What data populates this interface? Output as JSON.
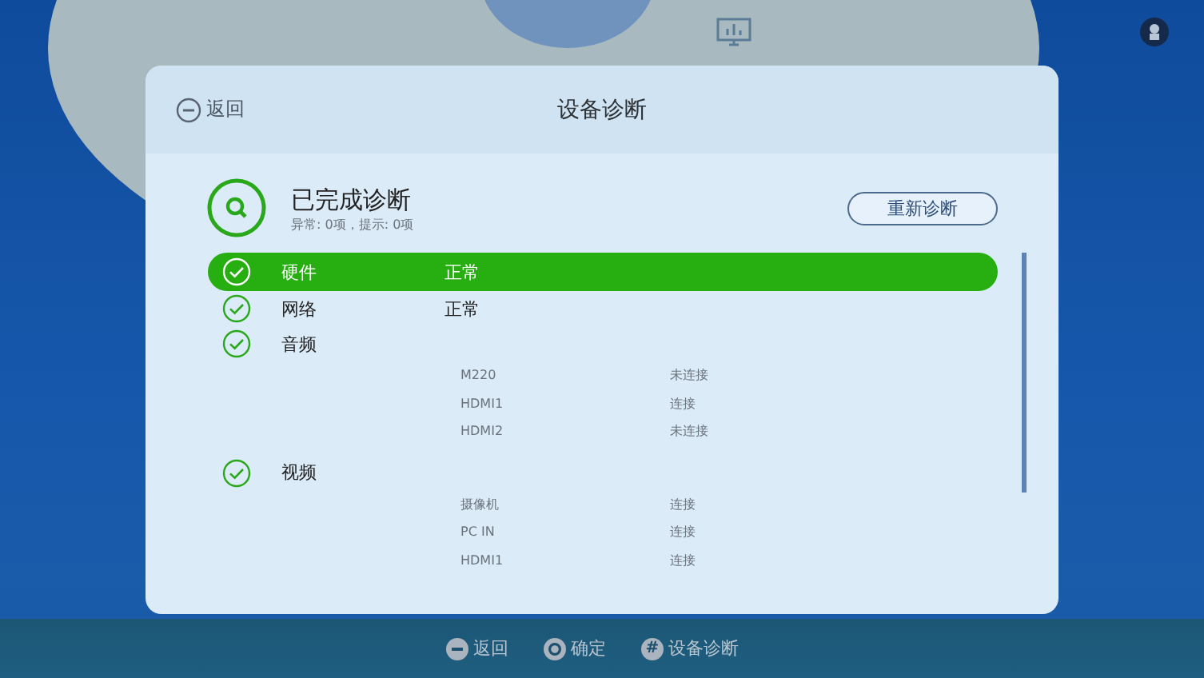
{
  "header": {
    "back": "返回",
    "title": "设备诊断"
  },
  "summary": {
    "title": "已完成诊断",
    "detail": "异常: 0项，提示: 0项",
    "rerun_button": "重新诊断"
  },
  "items": [
    {
      "name": "硬件",
      "status": "正常",
      "selected": true
    },
    {
      "name": "网络",
      "status": "正常",
      "selected": false
    },
    {
      "name": "音频",
      "selected": false,
      "children": [
        {
          "name": "M220",
          "status": "未连接"
        },
        {
          "name": "HDMI1",
          "status": "连接"
        },
        {
          "name": "HDMI2",
          "status": "未连接"
        }
      ]
    },
    {
      "name": "视频",
      "selected": false,
      "children": [
        {
          "name": "摄像机",
          "status": "连接"
        },
        {
          "name": "PC IN",
          "status": "连接"
        },
        {
          "name": "HDMI1",
          "status": "连接"
        }
      ]
    }
  ],
  "footer": [
    {
      "kind": "back",
      "label": "返回"
    },
    {
      "kind": "confirm",
      "label": "确定"
    },
    {
      "kind": "key",
      "key": "#",
      "label": "设备诊断"
    }
  ]
}
